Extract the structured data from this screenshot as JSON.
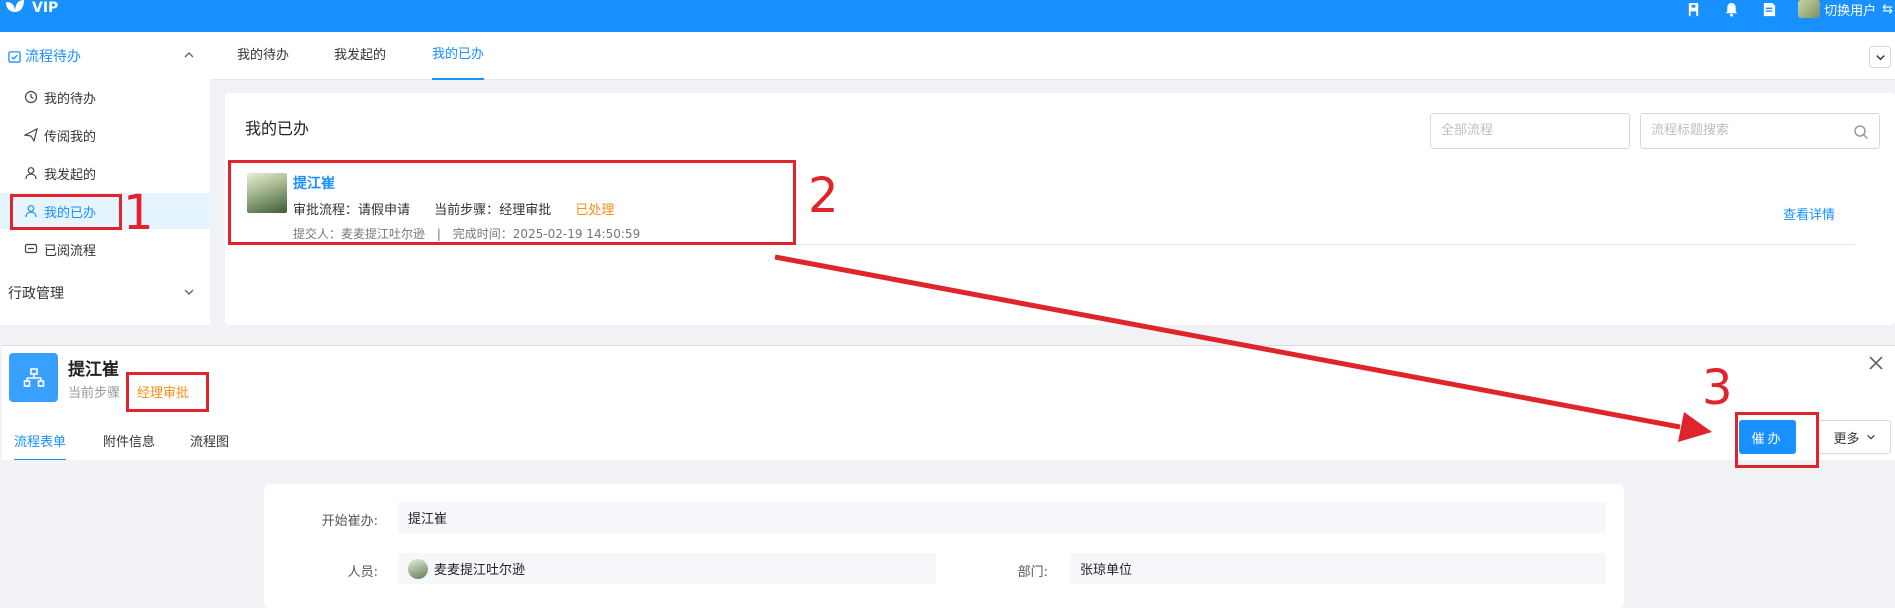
{
  "header": {
    "brand": "VIP",
    "switch_user": "切换用户",
    "swap_symbol": "⇆",
    "icons": [
      "org-icon",
      "bell-icon",
      "document-icon",
      "avatar"
    ]
  },
  "sidebar": {
    "group_flow": "流程待办",
    "items": [
      {
        "label": "我的待办",
        "icon": "clock-icon"
      },
      {
        "label": "传阅我的",
        "icon": "send-icon"
      },
      {
        "label": "我发起的",
        "icon": "user-icon"
      },
      {
        "label": "我的已办",
        "icon": "user-check-icon",
        "active": true
      },
      {
        "label": "已阅流程",
        "icon": "read-icon"
      }
    ],
    "group_admin": "行政管理"
  },
  "tabs": [
    {
      "label": "我的待办"
    },
    {
      "label": "我发起的"
    },
    {
      "label": "我的已办",
      "active": true
    }
  ],
  "content": {
    "title": "我的已办",
    "filter_placeholder": "全部流程",
    "search_placeholder": "流程标题搜索",
    "item": {
      "name": "提江崔",
      "flow_label": "审批流程：",
      "flow_value": "请假申请",
      "step_label": "当前步骤：",
      "step_value": "经理审批",
      "status": "已处理",
      "submitter_label": "提交人：",
      "submitter": "麦麦提江吐尔逊",
      "separator": "|",
      "finish_label": "完成时间：",
      "finish_time": "2025-02-19 14:50:59",
      "view_detail": "查看详情"
    }
  },
  "panel": {
    "title": "提江崔",
    "step_label": "当前步骤",
    "step_value": "经理审批",
    "tabs": [
      {
        "label": "流程表单",
        "active": true
      },
      {
        "label": "附件信息"
      },
      {
        "label": "流程图"
      }
    ],
    "urge_button": "催办",
    "more_button": "更多",
    "form": {
      "start_label": "开始崔办:",
      "start_value": "提江崔",
      "person_label": "人员:",
      "person_value": "麦麦提江吐尔逊",
      "dept_label": "部门:",
      "dept_value": "张琼单位"
    }
  },
  "annotations": {
    "n1": "1",
    "n2": "2",
    "n3": "3",
    "color": "#e0242b"
  }
}
